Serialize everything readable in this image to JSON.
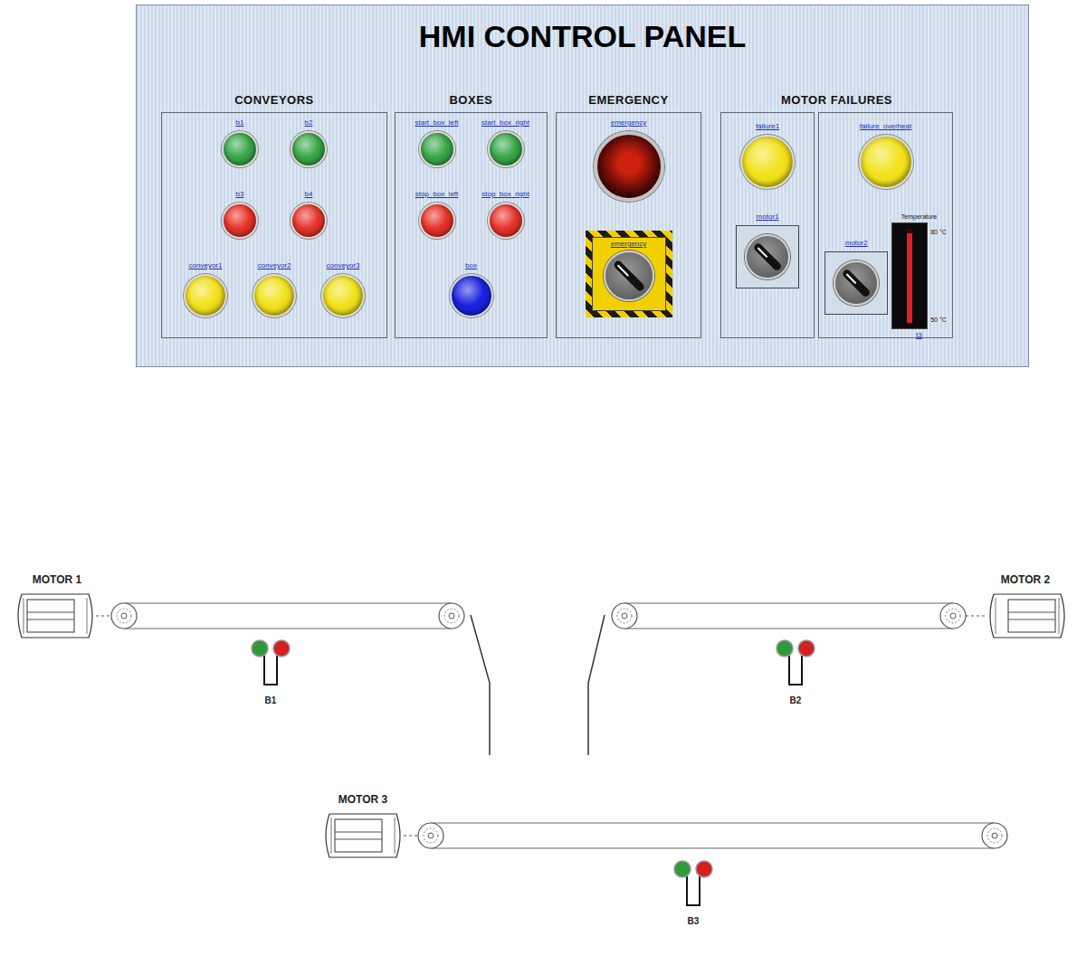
{
  "window": {
    "title": "HMI CONTROL PANEL"
  },
  "sections": [
    {
      "title": "CONVEYORS",
      "panels": [
        {
          "rows": [
            [
              {
                "kind": "button",
                "label": "b1",
                "color": "#3aa84a"
              },
              {
                "kind": "button",
                "label": "b2",
                "color": "#3aa84a"
              }
            ],
            [
              {
                "kind": "button",
                "label": "b3",
                "color": "#e8342a"
              },
              {
                "kind": "button",
                "label": "b4",
                "color": "#e8342a"
              }
            ],
            [
              {
                "kind": "lamp",
                "label": "conveyor1",
                "color": "#f2e21c",
                "on": true
              },
              {
                "kind": "lamp",
                "label": "conveyor2",
                "color": "#f2e21c",
                "on": true
              },
              {
                "kind": "lamp",
                "label": "conveyor3",
                "color": "#f2e21c",
                "on": true
              }
            ]
          ]
        }
      ]
    },
    {
      "title": "BOXES",
      "panels": [
        {
          "rows": [
            [
              {
                "kind": "button",
                "label": "start_box_left",
                "color": "#3aa84a"
              },
              {
                "kind": "button",
                "label": "start_box_right",
                "color": "#3aa84a"
              }
            ],
            [
              {
                "kind": "button",
                "label": "stop_box_left",
                "color": "#e8342a"
              },
              {
                "kind": "button",
                "label": "stop_box_right",
                "color": "#e8342a"
              }
            ],
            [
              {
                "kind": "lamp",
                "label": "box",
                "color": "#1a22e0",
                "on": true
              }
            ]
          ]
        }
      ]
    },
    {
      "title": "EMERGENCY",
      "panels": [
        {
          "rows": [
            [
              {
                "kind": "mushroom",
                "label": "emergency",
                "color": "#d0200f",
                "on": true
              }
            ],
            [
              {
                "kind": "hazard-selector",
                "label": "emergency",
                "on": false
              }
            ]
          ]
        }
      ]
    },
    {
      "title": "MOTOR FAILURES",
      "panels": [
        {
          "rows": [
            [
              {
                "kind": "lamp",
                "label": "failure1",
                "color": "#f2e21c",
                "on": true
              }
            ],
            [
              {
                "kind": "selector",
                "label": "motor1",
                "on": false
              }
            ]
          ]
        },
        {
          "rows": [
            [
              {
                "kind": "lamp",
                "label": "failure_overheat",
                "color": "#f2e21c",
                "on": true
              }
            ],
            [
              {
                "kind": "selector",
                "label": "motor2",
                "on": false
              },
              {
                "kind": "gauge",
                "label": "t3",
                "title": "Temperature",
                "max": "80 °C",
                "min": "50 °C",
                "level": 0.95,
                "color": "#e02020"
              }
            ]
          ]
        }
      ]
    }
  ],
  "diagram": {
    "conveyors": [
      {
        "motor": "MOTOR 1",
        "sensor": "B1",
        "green_on": true,
        "red_on": true
      },
      {
        "motor": "MOTOR 2",
        "sensor": "B2",
        "green_on": true,
        "red_on": true
      },
      {
        "motor": "MOTOR 3",
        "sensor": "B3",
        "green_on": true,
        "red_on": true
      }
    ]
  }
}
